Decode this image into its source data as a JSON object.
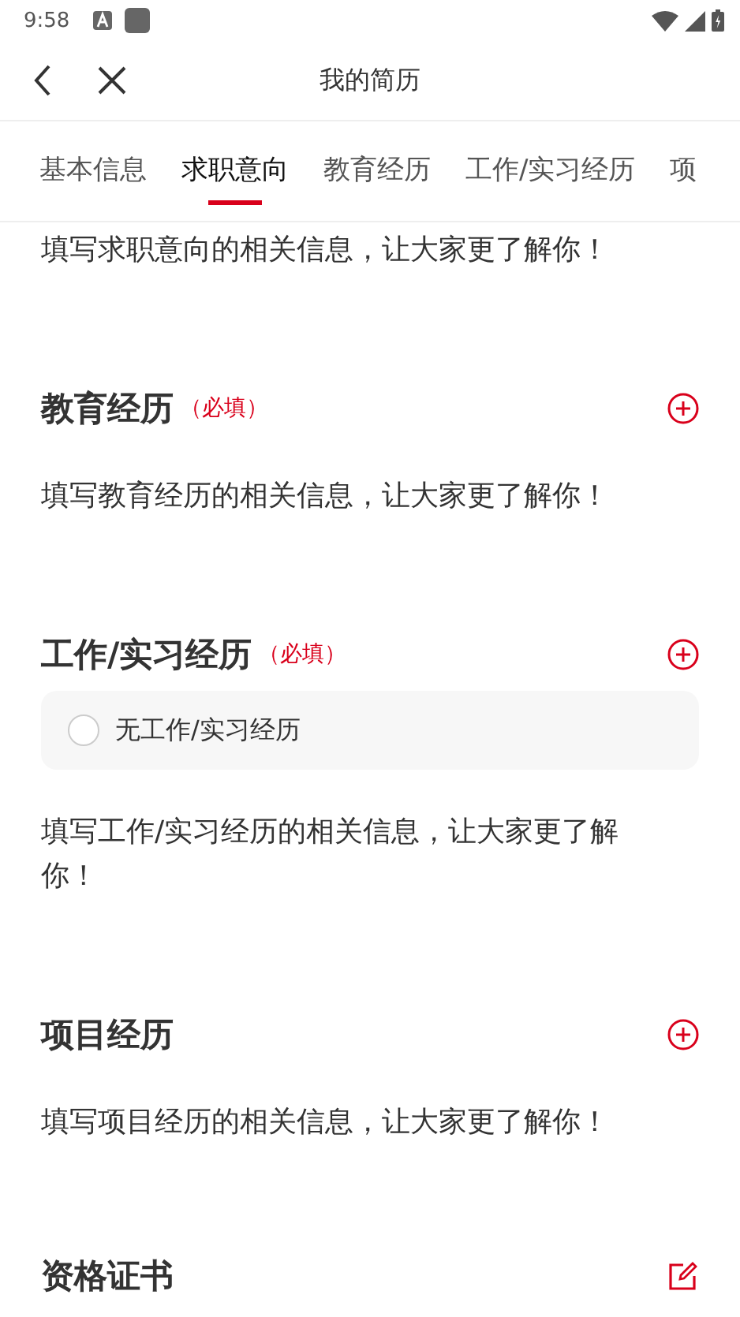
{
  "status_bar": {
    "time": "9:58"
  },
  "nav": {
    "title": "我的简历"
  },
  "tabs": [
    {
      "label": "基本信息",
      "selected": false
    },
    {
      "label": "求职意向",
      "selected": true
    },
    {
      "label": "教育经历",
      "selected": false
    },
    {
      "label": "工作/实习经历",
      "selected": false
    },
    {
      "label": "项",
      "selected": false
    }
  ],
  "sections": [
    {
      "description": "填写求职意向的相关信息，让大家更了解你！"
    },
    {
      "title": "教育经历",
      "required": "（必填）",
      "kind": "add",
      "description": "填写教育经历的相关信息，让大家更了解你！"
    },
    {
      "title": "工作/实习经历",
      "required": "（必填）",
      "kind": "add",
      "option": {
        "label": "无工作/实习经历",
        "checked": false
      },
      "description": "填写工作/实习经历的相关信息，让大家更了解你！"
    },
    {
      "title": "项目经历",
      "kind": "add",
      "description": "填写项目经历的相关信息，让大家更了解你！"
    },
    {
      "title": "资格证书",
      "kind": "edit"
    }
  ]
}
